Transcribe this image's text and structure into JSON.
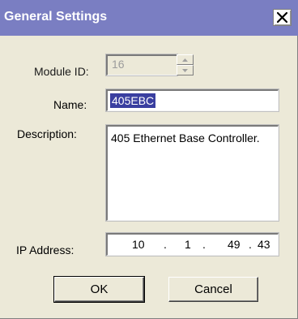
{
  "dialog": {
    "title": "General Settings"
  },
  "fields": {
    "module_id": {
      "label": "Module ID:",
      "value": "16"
    },
    "name": {
      "label": "Name:",
      "value": "405EBC"
    },
    "description": {
      "label": "Description:",
      "value": "405 Ethernet Base Controller."
    },
    "ip": {
      "label": "IP Address:",
      "octets": [
        "10",
        "1",
        "49",
        "43"
      ],
      "separator": "."
    }
  },
  "buttons": {
    "ok": "OK",
    "cancel": "Cancel"
  },
  "icons": {
    "close": "close-icon",
    "spin_up": "spin-up-icon",
    "spin_down": "spin-down-icon"
  },
  "colors": {
    "titlebar": "#7a7ec2",
    "selection": "#3a3fa0",
    "dialog_bg": "#ece9d8"
  }
}
